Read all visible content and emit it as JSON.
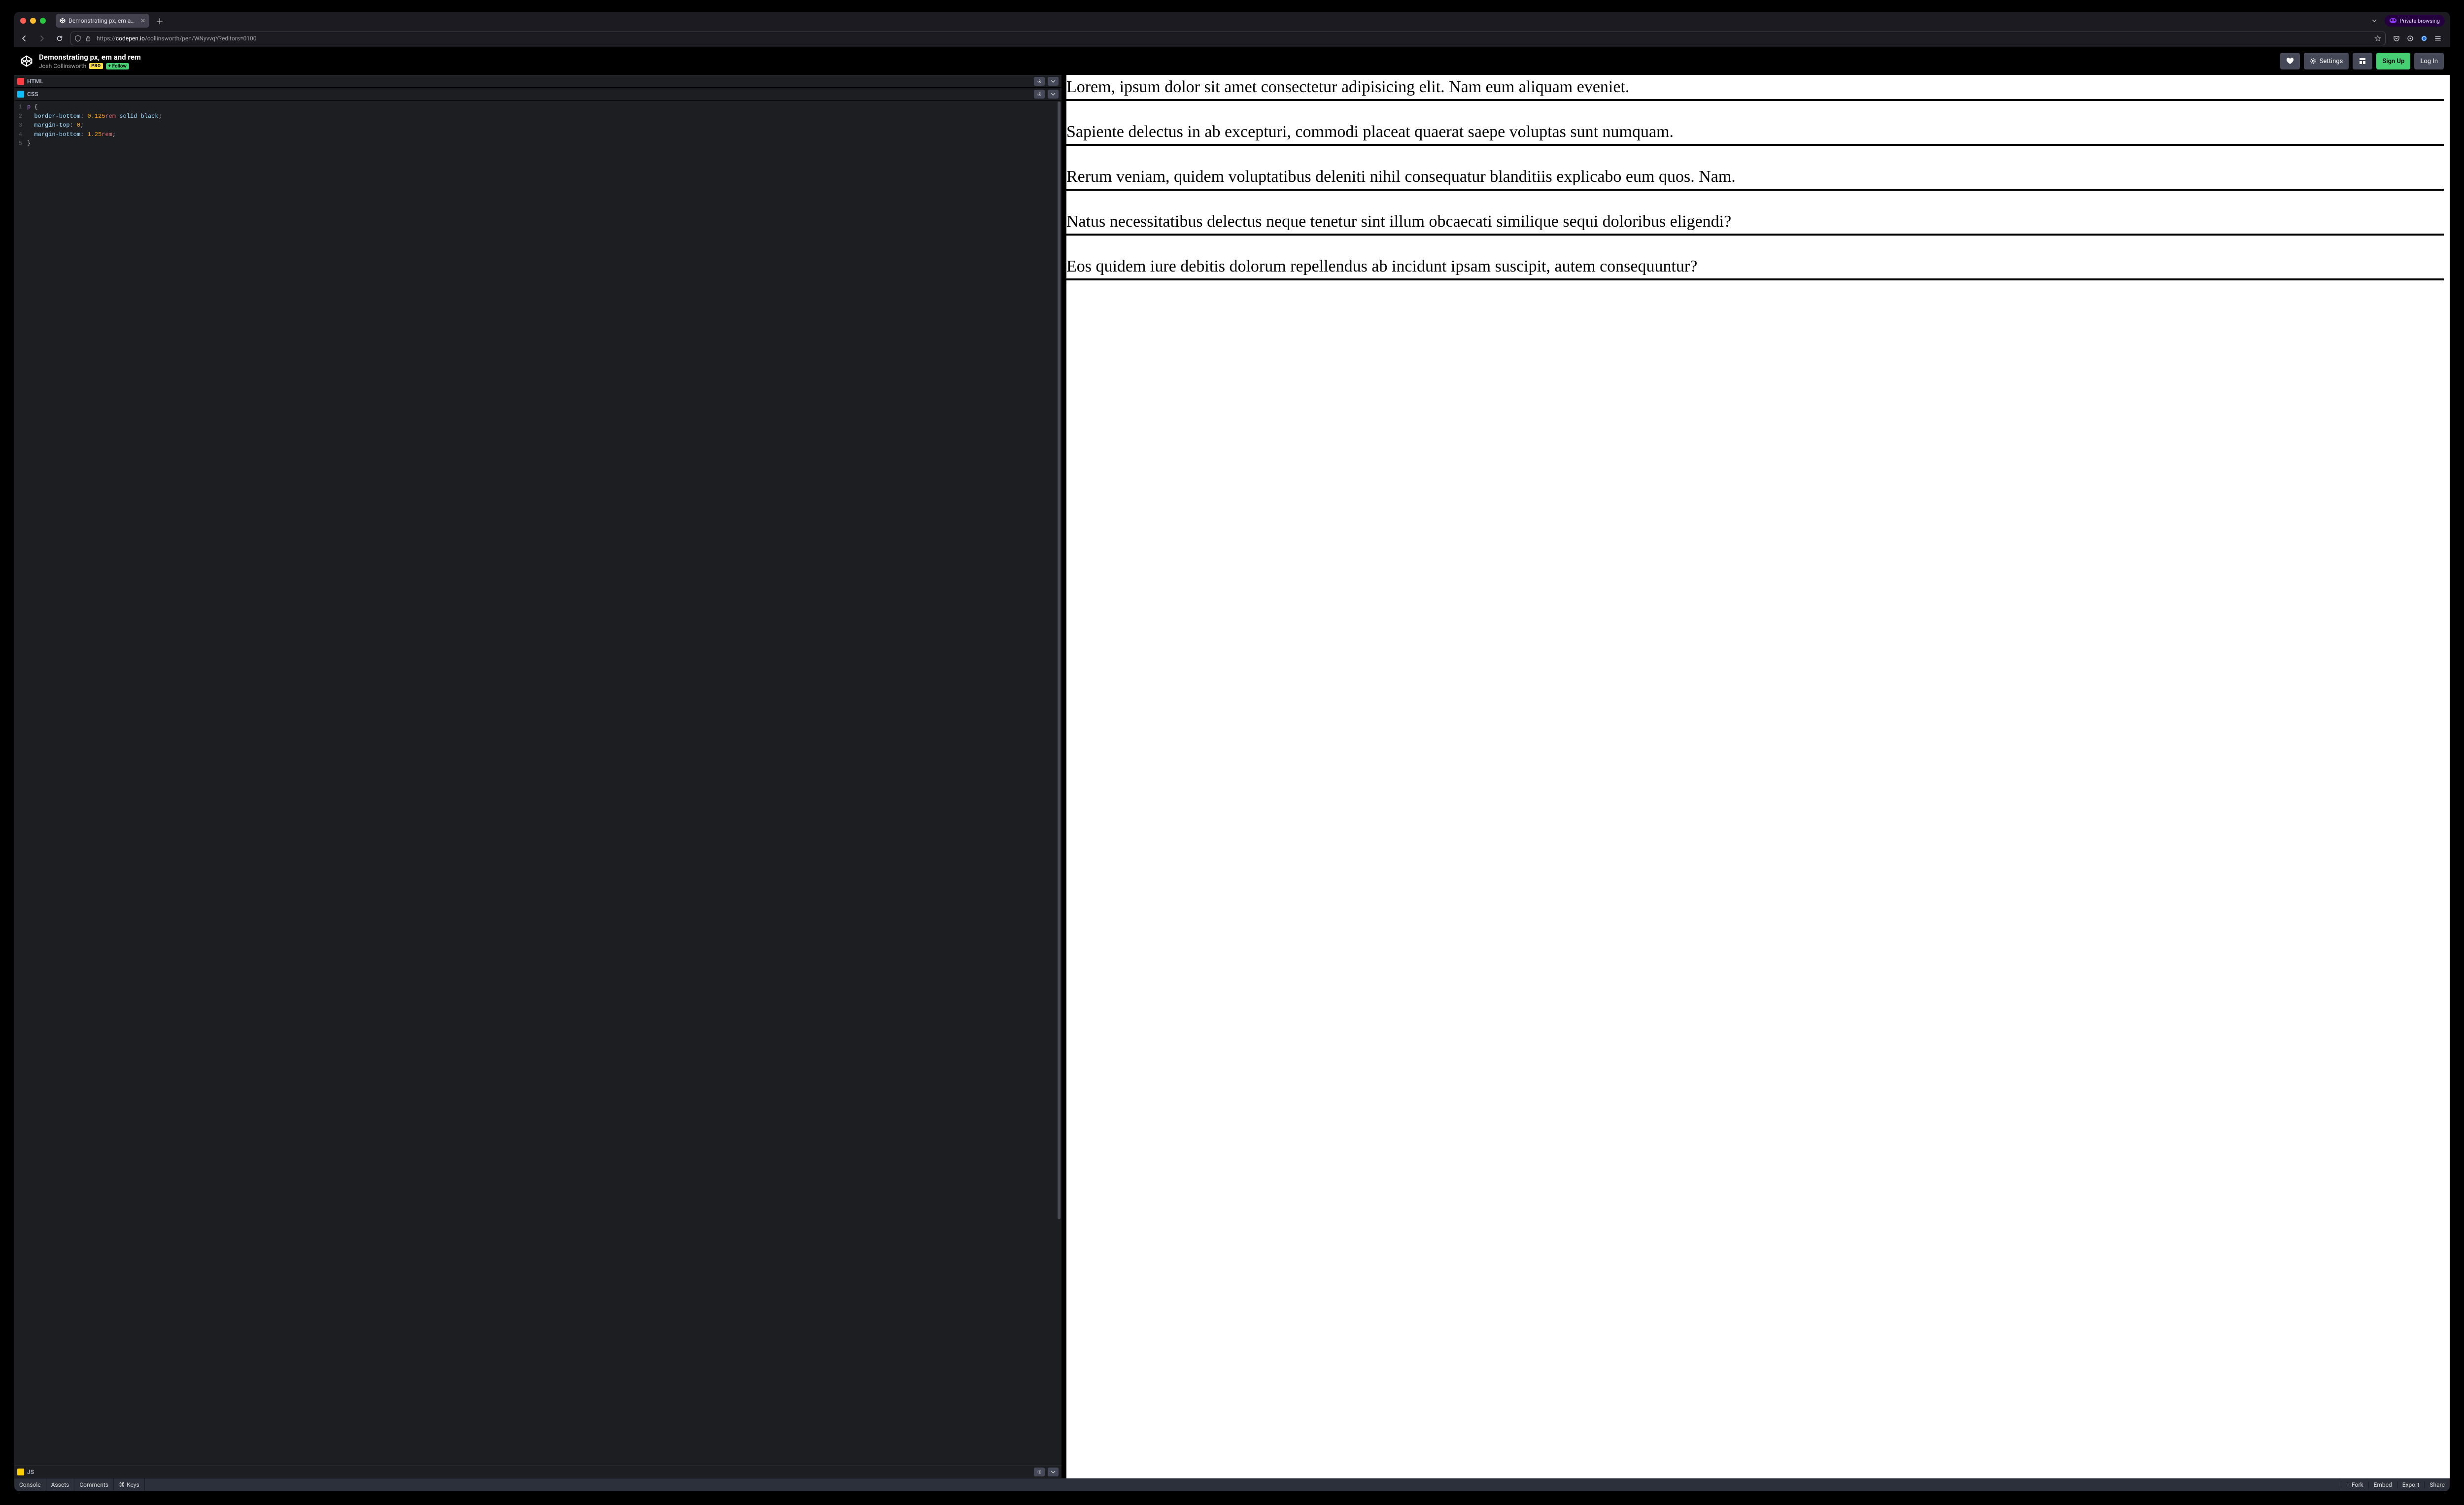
{
  "browser": {
    "tab_title": "Demonstrating px, em and rem",
    "private_label": "Private browsing",
    "url_prefix": "https://",
    "url_host": "codepen.io",
    "url_path": "/collinsworth/pen/WNyvvqY?editors=0100"
  },
  "codepen": {
    "pen_title": "Demonstrating px, em and rem",
    "author": "Josh Collinsworth",
    "pro_badge": "PRO",
    "follow_label": "+ Follow",
    "settings_label": "Settings",
    "signup_label": "Sign Up",
    "login_label": "Log In"
  },
  "editors": {
    "html_label": "HTML",
    "css_label": "CSS",
    "js_label": "JS"
  },
  "css_code": {
    "l1_sel": "p",
    "l1_brace": " {",
    "l2_prop": "  border-bottom",
    "l2_punc1": ": ",
    "l2_num": "0.125",
    "l2_unit": "rem",
    "l2_rest": " solid black",
    "l2_end": ";",
    "l3_prop": "  margin-top",
    "l3_punc1": ": ",
    "l3_num": "0",
    "l3_end": ";",
    "l4_prop": "  margin-bottom",
    "l4_punc1": ": ",
    "l4_num": "1.25",
    "l4_unit": "rem",
    "l4_end": ";",
    "l5": "}"
  },
  "preview": {
    "p1": "Lorem, ipsum dolor sit amet consectetur adipisicing elit. Nam eum aliquam eveniet.",
    "p2": "Sapiente delectus in ab excepturi, commodi placeat quaerat saepe voluptas sunt numquam.",
    "p3": "Rerum veniam, quidem voluptatibus deleniti nihil consequatur blanditiis explicabo eum quos. Nam.",
    "p4": "Natus necessitatibus delectus neque tenetur sint illum obcaecati similique sequi doloribus eligendi?",
    "p5": "Eos quidem iure debitis dolorum repellendus ab incidunt ipsam suscipit, autem consequuntur?"
  },
  "footer": {
    "console": "Console",
    "assets": "Assets",
    "comments": "Comments",
    "keys_prefix": "⌘",
    "keys_label": "Keys",
    "fork_prefix": "⑂",
    "fork": "Fork",
    "embed": "Embed",
    "export": "Export",
    "share": "Share"
  }
}
